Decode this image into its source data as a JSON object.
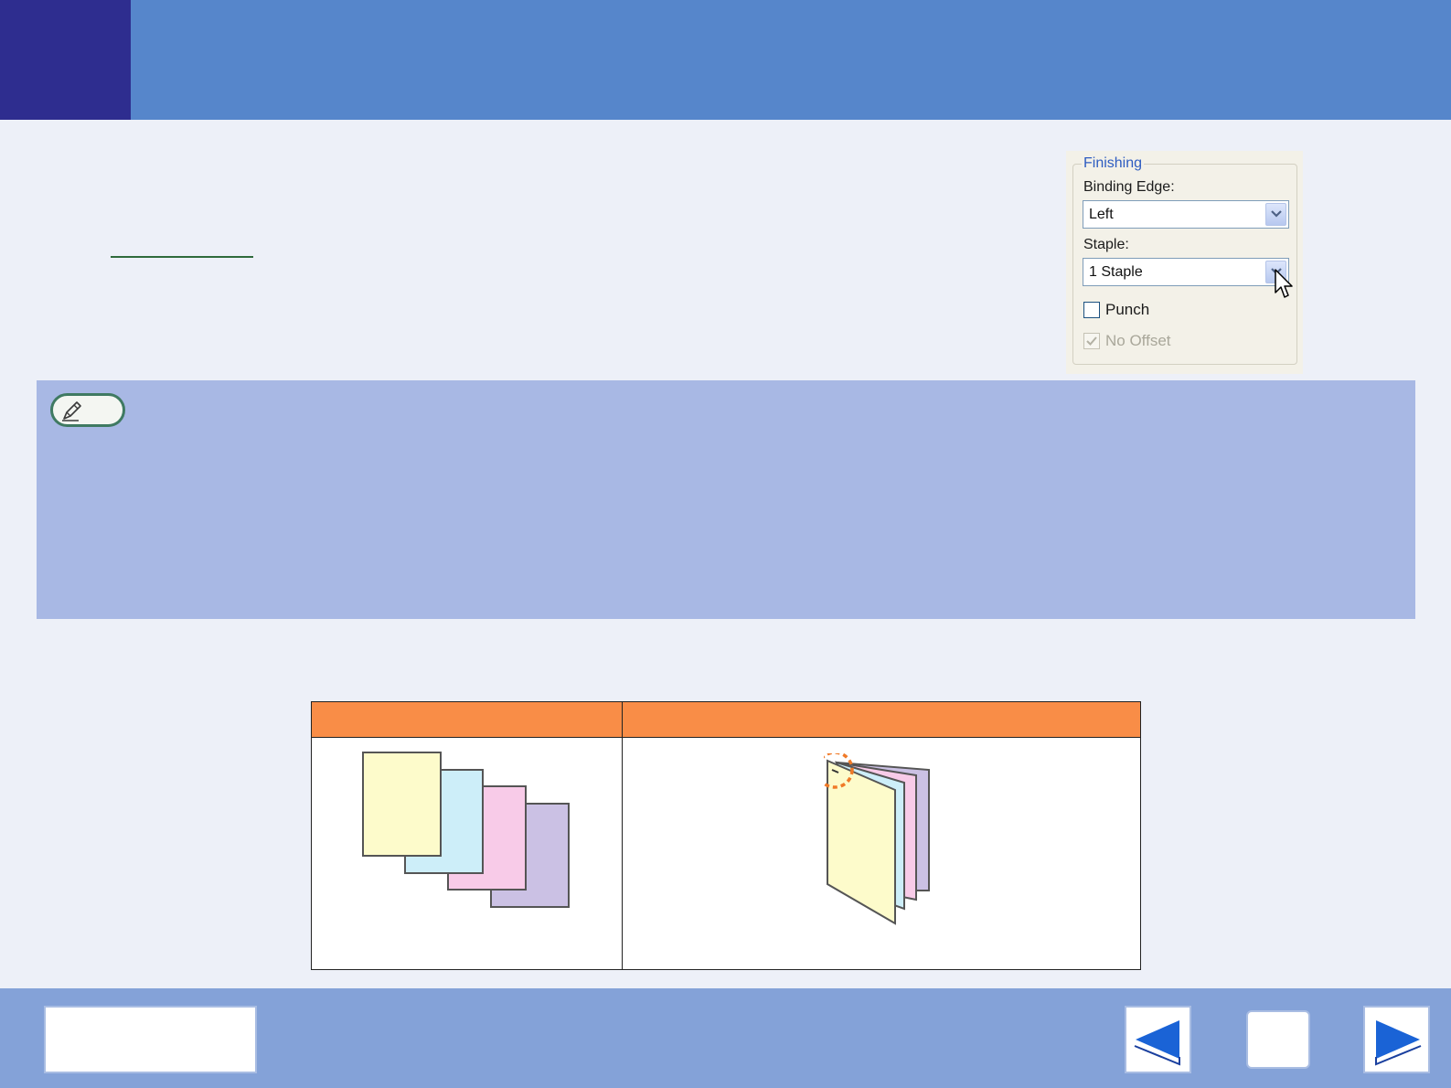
{
  "finishing": {
    "legend": "Finishing",
    "binding_edge_label": "Binding Edge:",
    "binding_edge_value": "Left",
    "staple_label": "Staple:",
    "staple_value": "1 Staple",
    "punch_label": "Punch",
    "punch_checked": false,
    "no_offset_label": "No Offset",
    "no_offset_checked": true,
    "no_offset_disabled": true
  },
  "colors": {
    "header_bg": "#5686cb",
    "header_block": "#2e2d8f",
    "page_bg": "#edf0f8",
    "note_bg": "#a8b8e4",
    "table_header": "#f98d47",
    "footer_bg": "#84a2d8",
    "nav_arrow": "#1a63d6"
  },
  "illustrations": {
    "left": "stacked-sheets-unstapled",
    "right": "stapled-booklet"
  },
  "icons": {
    "note": "pencil-icon",
    "prev": "left-arrow-icon",
    "home": "home-icon",
    "next": "right-arrow-icon"
  }
}
